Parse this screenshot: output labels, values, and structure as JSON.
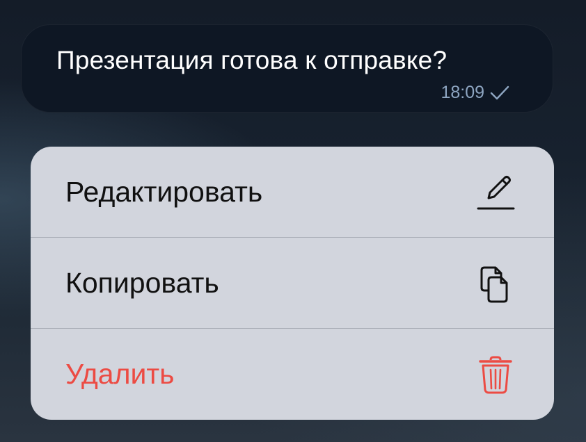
{
  "message": {
    "text": "Презентация готова к отправке?",
    "time": "18:09",
    "status_icon": "check-icon"
  },
  "context_menu": {
    "items": [
      {
        "label": "Редактировать",
        "icon": "pencil-icon"
      },
      {
        "label": "Копировать",
        "icon": "copy-icon"
      },
      {
        "label": "Удалить",
        "icon": "trash-icon",
        "destructive": true
      }
    ]
  },
  "colors": {
    "bubble": "#0e1724",
    "time": "#8ea6c2",
    "menu_bg": "#d2d5dd",
    "destructive": "#ec4b43"
  }
}
